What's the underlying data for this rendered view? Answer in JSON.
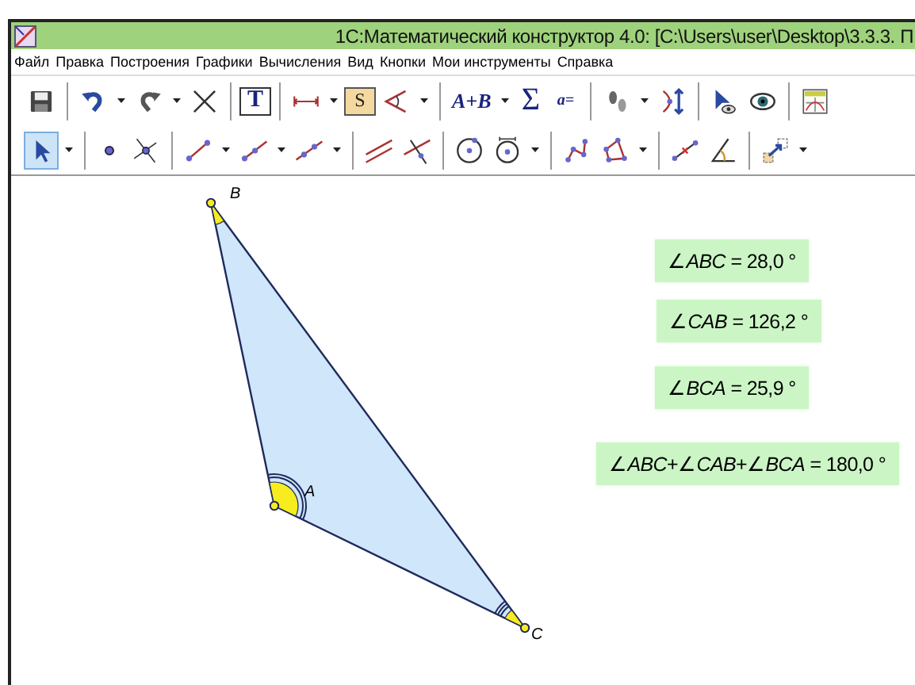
{
  "window": {
    "title": "1С:Математический конструктор 4.0: [C:\\Users\\user\\Desktop\\3.3.3. П"
  },
  "menu": [
    "Файл",
    "Правка",
    "Построения",
    "Графики",
    "Вычисления",
    "Вид",
    "Кнопки",
    "Мои инструменты",
    "Справка"
  ],
  "toolbar_1": [
    {
      "kind": "save"
    },
    {
      "kind": "separator"
    },
    {
      "kind": "undo",
      "dropdown": true
    },
    {
      "kind": "redo",
      "dropdown": true
    },
    {
      "kind": "delete"
    },
    {
      "kind": "separator"
    },
    {
      "kind": "text",
      "label": "T"
    },
    {
      "kind": "separator"
    },
    {
      "kind": "distance",
      "dropdown": true
    },
    {
      "kind": "sizebox",
      "label": "S"
    },
    {
      "kind": "angle",
      "dropdown": true
    },
    {
      "kind": "separator"
    },
    {
      "kind": "expression",
      "label": "A+B",
      "dropdown": true
    },
    {
      "kind": "sum",
      "label": "Σ"
    },
    {
      "kind": "parameter",
      "label": "a="
    },
    {
      "kind": "separator"
    },
    {
      "kind": "trace",
      "dropdown": true
    },
    {
      "kind": "locus"
    },
    {
      "kind": "separator"
    },
    {
      "kind": "showhide"
    },
    {
      "kind": "eye"
    },
    {
      "kind": "separator"
    },
    {
      "kind": "graph"
    }
  ],
  "toolbar_2": [
    {
      "kind": "pointer",
      "selected": true,
      "dropdown": true
    },
    {
      "kind": "separator"
    },
    {
      "kind": "point",
      "selected": false
    },
    {
      "kind": "intersection",
      "selected": false
    },
    {
      "kind": "separator"
    },
    {
      "kind": "segment",
      "selected": false,
      "dropdown": true
    },
    {
      "kind": "ray",
      "selected": false,
      "dropdown": true
    },
    {
      "kind": "line",
      "selected": false,
      "dropdown": true
    },
    {
      "kind": "separator"
    },
    {
      "kind": "parallel",
      "selected": false
    },
    {
      "kind": "perpendicular",
      "selected": false
    },
    {
      "kind": "separator"
    },
    {
      "kind": "circle",
      "selected": false
    },
    {
      "kind": "circle_radius",
      "selected": false,
      "dropdown": true
    },
    {
      "kind": "separator"
    },
    {
      "kind": "polyline",
      "selected": false
    },
    {
      "kind": "polygon",
      "selected": false,
      "dropdown": true
    },
    {
      "kind": "separator"
    },
    {
      "kind": "midpoint",
      "selected": false
    },
    {
      "kind": "angle_mark",
      "selected": false
    },
    {
      "kind": "separator"
    },
    {
      "kind": "transform",
      "selected": false,
      "dropdown": true
    }
  ],
  "points": [
    {
      "label": "B"
    },
    {
      "label": "A"
    },
    {
      "label": "C"
    }
  ],
  "measurements": [
    {
      "text": "∠*ABC* = 28,0 °"
    },
    {
      "text": "∠*CAB* = 126,2 °"
    },
    {
      "text": "∠*BCA* = 25,9 °"
    },
    {
      "text": "∠*ABC*+∠*CAB*+∠*BCA* = 180,0 °"
    }
  ]
}
